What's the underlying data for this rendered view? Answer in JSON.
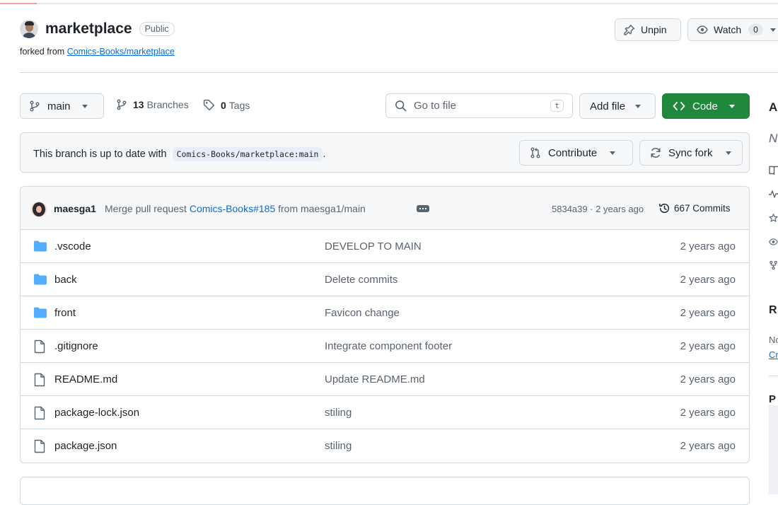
{
  "repo": {
    "name": "marketplace",
    "visibility": "Public",
    "forked_prefix": "forked from",
    "forked_from": "Comics-Books/marketplace"
  },
  "actions": {
    "unpin": "Unpin",
    "watch": "Watch",
    "watch_count": "0"
  },
  "toolbar": {
    "branch": "main",
    "branches_count": "13",
    "branches_label": "Branches",
    "tags_count": "0",
    "tags_label": "Tags",
    "search_placeholder": "Go to file",
    "search_key": "t",
    "add_file": "Add file",
    "code": "Code"
  },
  "banner": {
    "message": "This branch is up to date with",
    "ref": "Comics-Books/marketplace:main",
    "period": ".",
    "contribute": "Contribute",
    "sync_fork": "Sync fork"
  },
  "latest_commit": {
    "author": "maesga1",
    "message_prefix": "Merge pull request",
    "pr_link": "Comics-Books#185",
    "message_suffix": "from maesga1/main",
    "hash_time": "5834a39 · 2 years ago",
    "commits": "667 Commits"
  },
  "files": [
    {
      "type": "folder",
      "name": ".vscode",
      "message": "DEVELOP TO MAIN",
      "age": "2 years ago"
    },
    {
      "type": "folder",
      "name": "back",
      "message": "Delete commits",
      "age": "2 years ago"
    },
    {
      "type": "folder",
      "name": "front",
      "message": "Favicon change",
      "age": "2 years ago"
    },
    {
      "type": "file",
      "name": ".gitignore",
      "message": "Integrate component footer",
      "age": "2 years ago"
    },
    {
      "type": "file",
      "name": "README.md",
      "message": "Update README.md",
      "age": "2 years ago"
    },
    {
      "type": "file",
      "name": "package-lock.json",
      "message": "stiling",
      "age": "2 years ago"
    },
    {
      "type": "file",
      "name": "package.json",
      "message": "stiling",
      "age": "2 years ago"
    }
  ],
  "sidebar": {
    "about_fragment": "A",
    "desc_fragment": "N",
    "releases_fragment": "R",
    "no_fragment": "No",
    "create_fragment": "Cr",
    "packages_fragment": "P"
  },
  "colors": {
    "accent": "#0969da",
    "code_button": "#1f883d",
    "folder_icon": "#54aeff"
  }
}
